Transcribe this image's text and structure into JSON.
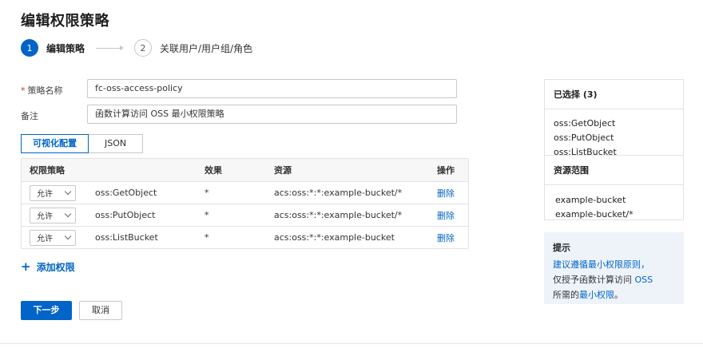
{
  "page_title": "编辑权限策略",
  "steps": [
    {
      "num": "1",
      "label": "编辑策略"
    },
    {
      "num": "2",
      "label": "关联用户/用户组/角色"
    }
  ],
  "form": {
    "policy_name_label": "策略名称",
    "policy_name_value": "fc-oss-access-policy",
    "note_label": "备注",
    "note_value": "函数计算访问 OSS 最小权限策略"
  },
  "tabs": {
    "visual": "可视化配置",
    "json": "JSON"
  },
  "table": {
    "headers": {
      "policy": "权限策略",
      "effect": "效果",
      "resource": "资源",
      "action": "操作"
    },
    "rows": [
      {
        "effect": "允许",
        "action_name": "oss:GetObject",
        "effect_value": "*",
        "resource": "acs:oss:*:*:example-bucket/*",
        "op": "删除"
      },
      {
        "effect": "允许",
        "action_name": "oss:PutObject",
        "effect_value": "*",
        "resource": "acs:oss:*:*:example-bucket/*",
        "op": "删除"
      },
      {
        "effect": "允许",
        "action_name": "oss:ListBucket",
        "effect_value": "*",
        "resource": "acs:oss:*:*:example-bucket",
        "op": "删除"
      }
    ]
  },
  "add_permission": "添加权限",
  "buttons": {
    "next": "下一步",
    "cancel": "取消"
  },
  "selected_panel": {
    "title": "已选择 (3)",
    "items": [
      "oss:GetObject",
      "oss:PutObject",
      "oss:ListBucket"
    ],
    "resource_title": "资源范围",
    "resources": [
      "example-bucket",
      "example-bucket/*"
    ]
  },
  "tip": {
    "title": "提示",
    "line1_pre": "建议遵循",
    "line1_link": "最小权限原则",
    "line1_post": "，",
    "line2_pre": "仅授予函数计算访问 ",
    "line2_link": "OSS",
    "line3_pre": "所需的",
    "line3_link": "最小权限",
    "line3_post": "。"
  },
  "colors": {
    "accent": "#0064c8",
    "tip_bg": "#eef3fa"
  }
}
